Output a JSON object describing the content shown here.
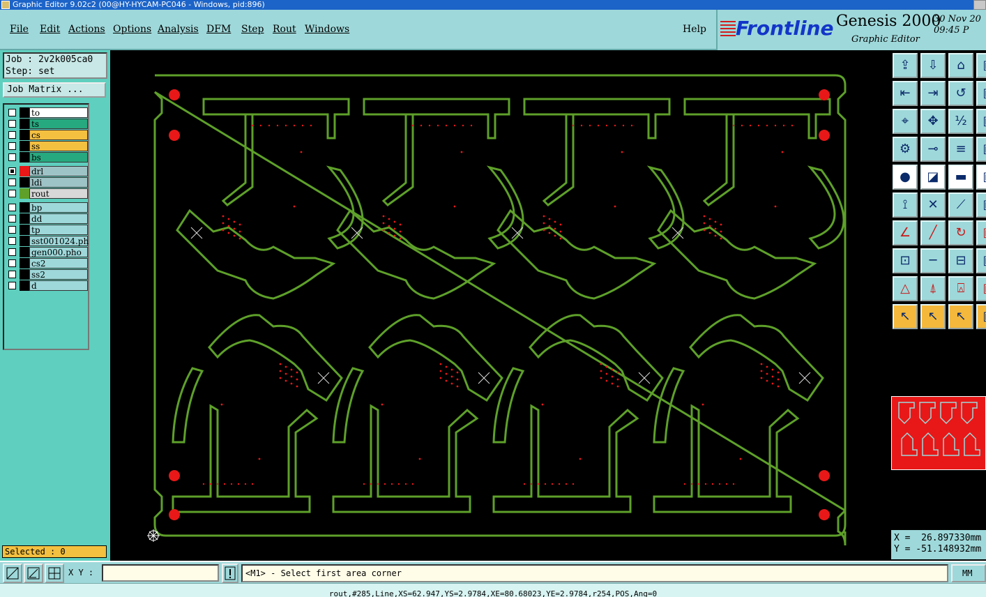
{
  "window": {
    "title": "Graphic Editor 9.02c2 (00@HY-HYCAM-PC046 - Windows, pid:896)"
  },
  "menu": {
    "file": "File",
    "edit": "Edit",
    "actions": "Actions",
    "options": "Options",
    "analysis": "Analysis",
    "dfm": "DFM",
    "step": "Step",
    "rout": "Rout",
    "windows": "Windows",
    "help": "Help"
  },
  "brand": {
    "logo": "Frontline",
    "product": "Genesis 2000",
    "subtitle": "Graphic Editor",
    "date": "30 Nov 20",
    "time": "09:45 P"
  },
  "job": {
    "job_line": "Job : 2v2k005ca0",
    "step_line": "Step: set",
    "matrix_button": "Job Matrix ..."
  },
  "colors": {
    "accent": "#9ed8da",
    "outline": "#5ea02a",
    "pad": "#e81818",
    "panel": "#5fcfbf"
  },
  "layers": [
    {
      "name": "to",
      "color": "#ffffff",
      "checked": false
    },
    {
      "name": "ts",
      "color": "#27a97f",
      "checked": false
    },
    {
      "name": "cs",
      "color": "#f4c040",
      "checked": false
    },
    {
      "name": "ss",
      "color": "#f4c040",
      "checked": false
    },
    {
      "name": "bs",
      "color": "#27a97f",
      "checked": false
    },
    {
      "name": "drl",
      "color": "#9ec3c6",
      "checked": true,
      "swatch": "#e81818"
    },
    {
      "name": "ldi",
      "color": "#9ec3c6",
      "checked": false
    },
    {
      "name": "rout",
      "color": "#d8d8d8",
      "checked": false,
      "swatch": "#5ea02a"
    },
    {
      "name": "bp",
      "color": "#9ed8da",
      "checked": false
    },
    {
      "name": "dd",
      "color": "#9ed8da",
      "checked": false
    },
    {
      "name": "tp",
      "color": "#9ed8da",
      "checked": false
    },
    {
      "name": "sst001024.ph",
      "color": "#9ed8da",
      "checked": false
    },
    {
      "name": "gen000.pho",
      "color": "#9ed8da",
      "checked": false
    },
    {
      "name": "cs2",
      "color": "#9ed8da",
      "checked": false
    },
    {
      "name": "ss2",
      "color": "#9ed8da",
      "checked": false
    },
    {
      "name": "d",
      "color": "#9ed8da",
      "checked": false
    }
  ],
  "selected": "Selected : 0",
  "coords": {
    "x": "X =  26.897330mm",
    "y": "Y = -51.148932mm"
  },
  "bottom": {
    "xy_label": "X Y :",
    "xy_value": "",
    "prompt": "<M1> - Select first area corner",
    "units": "MM",
    "feature_info": "rout,#285,Line,XS=62.947,YS=2.9784,XE=80.68023,YE=2.9784,r254,POS,Ang=0"
  },
  "toolbar_icons": [
    "open-job-icon",
    "save-icon",
    "home-icon",
    "panel-icon",
    "snap-in-icon",
    "snap-out-icon",
    "flip-icon",
    "panel2-icon",
    "fit-icon",
    "zoom-area-icon",
    "scale-1-2-icon",
    "panel3-icon",
    "measure-icon",
    "rout-tool-icon",
    "layer-stack-icon",
    "panel4-icon",
    "pad-icon",
    "line-draw-icon",
    "ruler-icon",
    "panel5-icon",
    "connect-icon",
    "cross-icon",
    "arc-point-icon",
    "panel6-icon",
    "line-angle-icon",
    "line-slant-icon",
    "arc-icon",
    "panel7-icon",
    "pad-select-icon",
    "line-icon",
    "dimension-icon",
    "panel8-icon",
    "triangle-icon",
    "arrow-a-icon",
    "polygon-icon",
    "panel9-icon",
    "select-pointer-icon",
    "select-box-icon",
    "select-shape-icon",
    "panel10-icon"
  ]
}
